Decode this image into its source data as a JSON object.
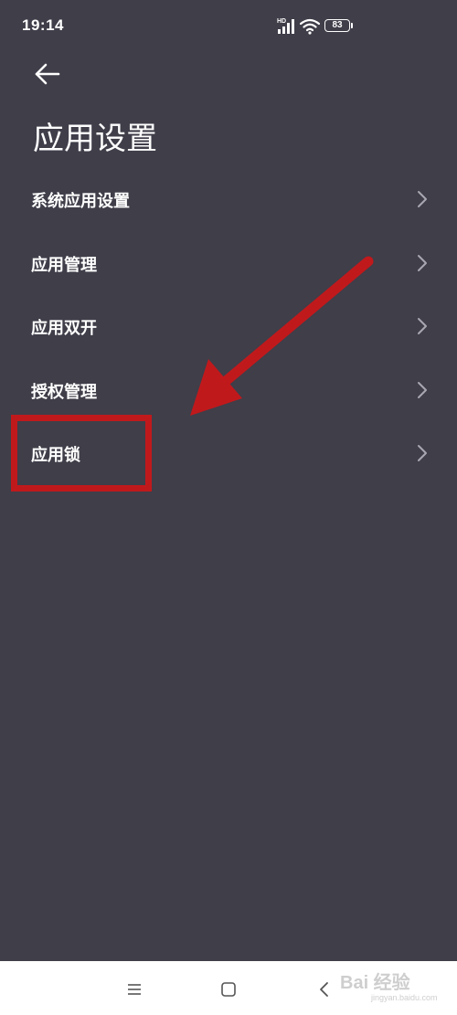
{
  "status_bar": {
    "time": "19:14",
    "battery_level": "83",
    "network_badge": "HD",
    "icons": [
      "signal-icon",
      "wifi-icon",
      "battery-icon"
    ]
  },
  "header": {
    "back_icon": "back-arrow-icon",
    "title": "应用设置"
  },
  "menu": {
    "items": [
      {
        "label": "系统应用设置",
        "icon": "chevron-right-icon"
      },
      {
        "label": "应用管理",
        "icon": "chevron-right-icon"
      },
      {
        "label": "应用双开",
        "icon": "chevron-right-icon"
      },
      {
        "label": "授权管理",
        "icon": "chevron-right-icon"
      },
      {
        "label": "应用锁",
        "icon": "chevron-right-icon"
      }
    ]
  },
  "annotation": {
    "color": "#c0191c",
    "highlighted_item": "应用锁"
  },
  "nav_bar": {
    "icons": [
      "menu-icon",
      "home-square-icon",
      "back-chevron-icon"
    ]
  },
  "watermark": {
    "main": "Bai 经验",
    "sub": "jingyan.baidu.com"
  },
  "colors": {
    "background": "#3f3e49",
    "text": "#ffffff",
    "chevron": "#a9a8b1",
    "nav_background": "#ffffff"
  }
}
